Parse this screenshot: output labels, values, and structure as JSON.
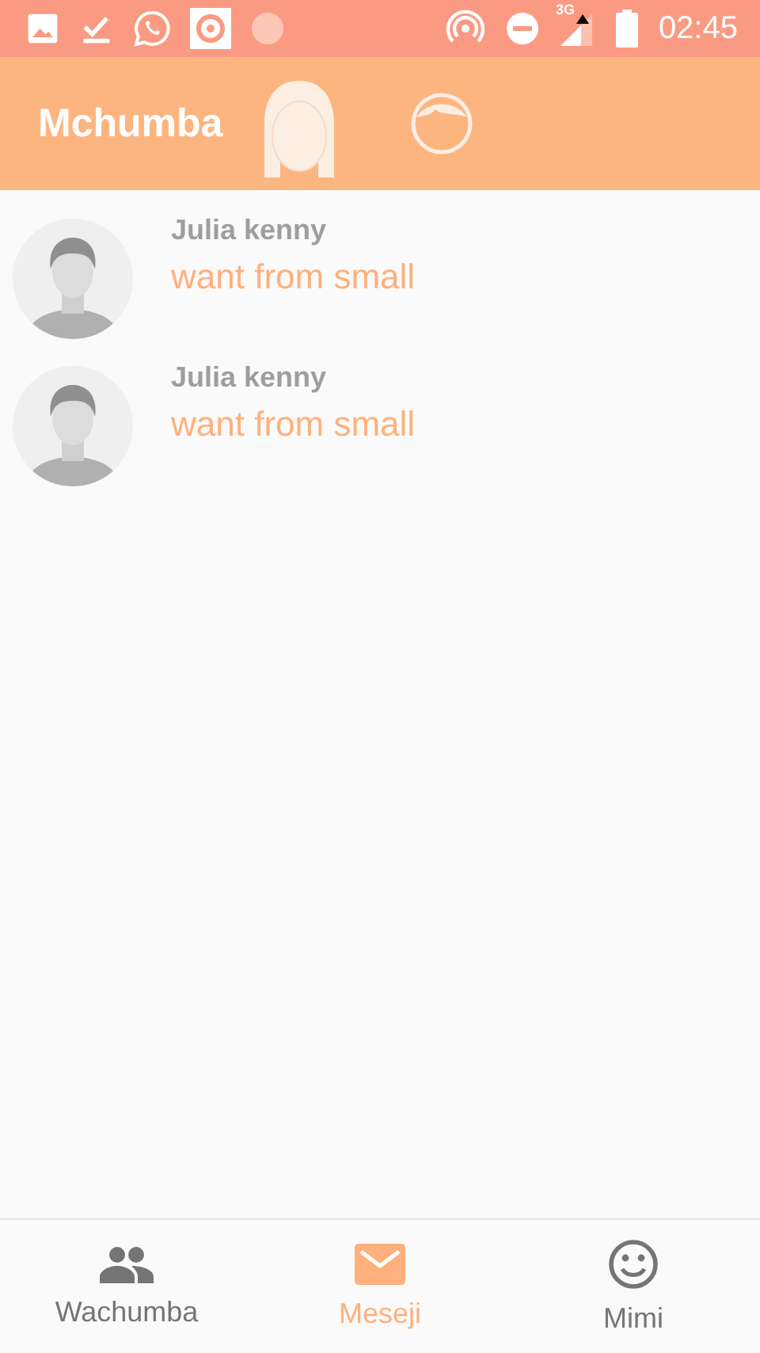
{
  "status_bar": {
    "time": "02:45",
    "network": "3G"
  },
  "app_bar": {
    "title": "Mchumba"
  },
  "chats": [
    {
      "name": "Julia kenny",
      "message": "want from small"
    },
    {
      "name": "Julia kenny",
      "message": "want from small"
    }
  ],
  "tabs": [
    {
      "label": "Wachumba",
      "kind": "people",
      "selected": false
    },
    {
      "label": "Meseji",
      "kind": "mail",
      "selected": true
    },
    {
      "label": "Mimi",
      "kind": "smiley",
      "selected": false
    }
  ]
}
